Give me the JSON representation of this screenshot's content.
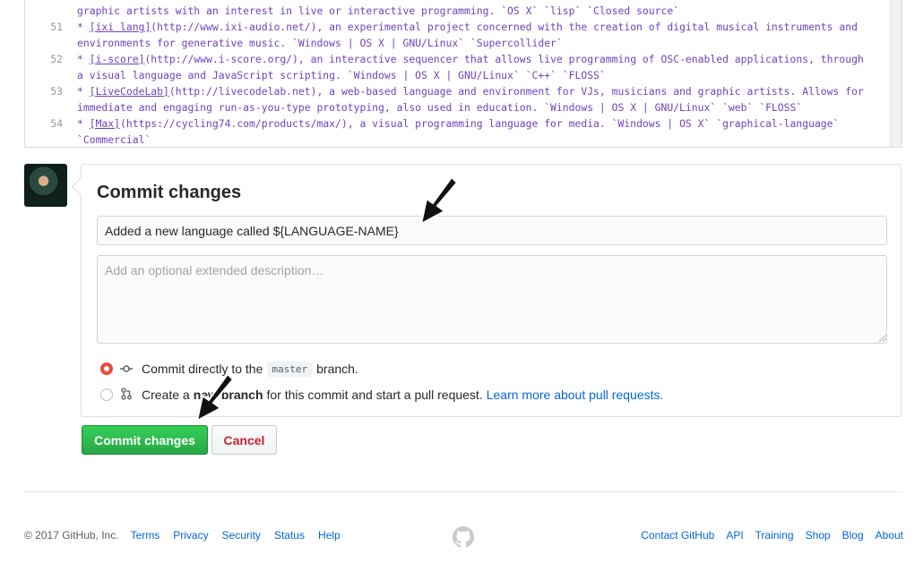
{
  "editor": {
    "lines": [
      {
        "num": "",
        "segments": [
          {
            "t": "graphic artists with an interest in live or interactive programming. `OS X` `lisp` `Closed source`"
          }
        ]
      },
      {
        "num": "51",
        "segments": [
          {
            "t": "* "
          },
          {
            "t": "[ixi lang]",
            "link": true
          },
          {
            "t": "(http://www.ixi-audio.net/), an experimental project concerned with the creation of digital musical instruments and"
          }
        ]
      },
      {
        "num": "",
        "segments": [
          {
            "t": "environments for generative music. `Windows | OS X | GNU/Linux` `Supercollider`"
          }
        ]
      },
      {
        "num": "52",
        "segments": [
          {
            "t": "* "
          },
          {
            "t": "[i-score]",
            "link": true
          },
          {
            "t": "(http://www.i-score.org/), an interactive sequencer that allows live programming of OSC-enabled applications, through"
          }
        ]
      },
      {
        "num": "",
        "segments": [
          {
            "t": "a visual language and JavaScript scripting. `Windows | OS X | GNU/Linux` `C++` `FLOSS`"
          }
        ]
      },
      {
        "num": "53",
        "segments": [
          {
            "t": "* "
          },
          {
            "t": "[LiveCodeLab]",
            "link": true
          },
          {
            "t": "(http://livecodelab.net), a web-based language and environment for VJs, musicians and graphic artists. Allows for"
          }
        ]
      },
      {
        "num": "",
        "segments": [
          {
            "t": "immediate and engaging run-as-you-type prototyping, also used in education. `Windows | OS X | GNU/Linux` `web` `FLOSS`"
          }
        ]
      },
      {
        "num": "54",
        "segments": [
          {
            "t": "* "
          },
          {
            "t": "[Max]",
            "link": true
          },
          {
            "t": "(https://cycling74.com/products/max/), a visual programming language for media. `Windows | OS X` `graphical-language`"
          }
        ]
      },
      {
        "num": "",
        "segments": [
          {
            "t": "`Commercial`"
          }
        ]
      }
    ]
  },
  "commit": {
    "title": "Commit changes",
    "summary_value": "Added a new language called ${LANGUAGE-NAME}",
    "description_placeholder": "Add an optional extended description…",
    "option_direct": {
      "before": "Commit directly to the",
      "branch": "master",
      "after": "branch."
    },
    "option_new": {
      "before": "Create a",
      "bold": "new branch",
      "after": "for this commit and start a pull request.",
      "link": "Learn more about pull requests."
    },
    "commit_button": "Commit changes",
    "cancel_button": "Cancel"
  },
  "footer": {
    "copyright": "© 2017 GitHub, Inc.",
    "left_links": [
      "Terms",
      "Privacy",
      "Security",
      "Status",
      "Help"
    ],
    "right_links": [
      "Contact GitHub",
      "API",
      "Training",
      "Shop",
      "Blog",
      "About"
    ]
  },
  "colors": {
    "accent": "#28a745",
    "link": "#0366d6",
    "danger": "#cb2431",
    "code": "#6f42c1"
  }
}
